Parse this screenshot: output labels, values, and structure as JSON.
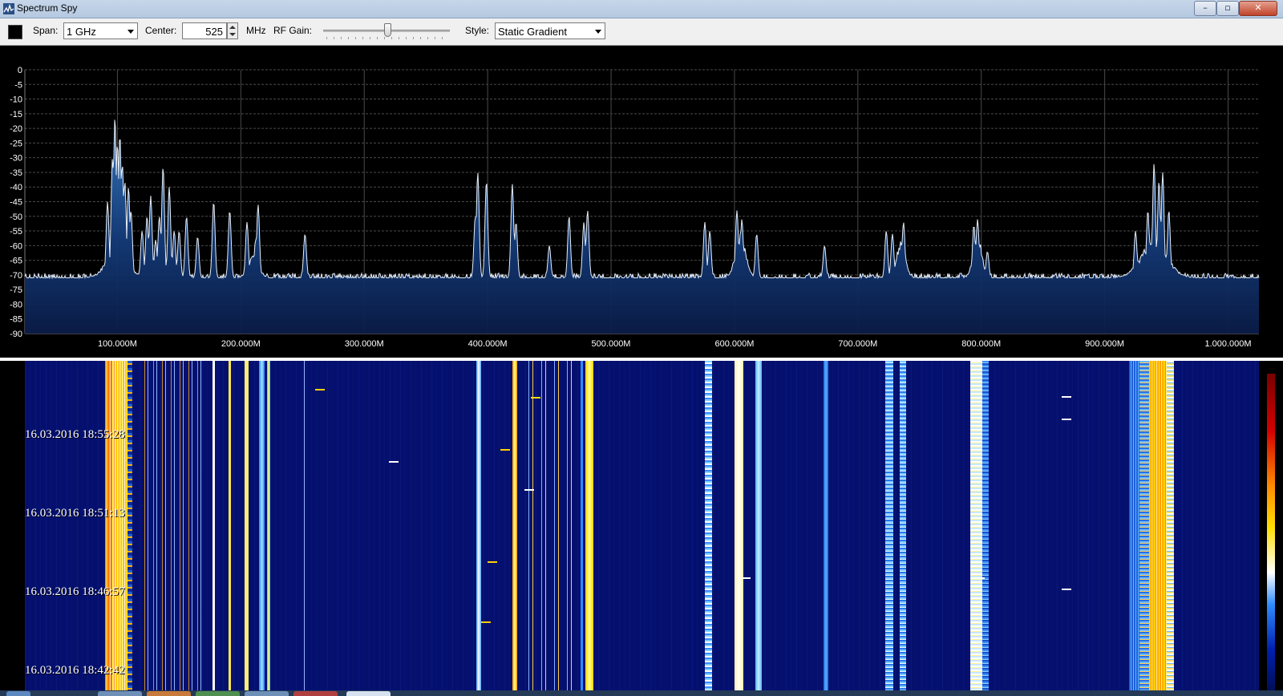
{
  "window": {
    "title": "Spectrum Spy"
  },
  "titlebar_buttons": {
    "minimize": "–",
    "maximize": "▫",
    "close": "✕"
  },
  "toolbar": {
    "span_label": "Span:",
    "span_value": "1 GHz",
    "center_label": "Center:",
    "center_value": "525",
    "center_unit": "MHz",
    "rf_gain_label": "RF Gain:",
    "rf_gain_level_percent": 52,
    "style_label": "Style:",
    "style_value": "Static Gradient"
  },
  "spectrum": {
    "y_ticks": [
      "0",
      "-5",
      "-10",
      "-15",
      "-20",
      "-25",
      "-30",
      "-35",
      "-40",
      "-45",
      "-50",
      "-55",
      "-60",
      "-65",
      "-70",
      "-75",
      "-80",
      "-85",
      "-90"
    ],
    "x_ticks": [
      "100.000M",
      "200.000M",
      "300.000M",
      "400.000M",
      "500.000M",
      "600.000M",
      "700.000M",
      "800.000M",
      "900.000M",
      "1.000.000M"
    ],
    "x_range_mhz": [
      25,
      1025
    ],
    "y_range_db": [
      0,
      -90
    ],
    "noise_floor_db": -71,
    "peaks": [
      {
        "mhz": 92,
        "db": -45
      },
      {
        "mhz": 96,
        "db": -30
      },
      {
        "mhz": 98,
        "db": -16
      },
      {
        "mhz": 100,
        "db": -25
      },
      {
        "mhz": 102,
        "db": -22
      },
      {
        "mhz": 104,
        "db": -32
      },
      {
        "mhz": 106,
        "db": -38
      },
      {
        "mhz": 109,
        "db": -40
      },
      {
        "mhz": 111,
        "db": -48
      },
      {
        "mhz": 120,
        "db": -55
      },
      {
        "mhz": 124,
        "db": -50
      },
      {
        "mhz": 127,
        "db": -43
      },
      {
        "mhz": 131,
        "db": -58
      },
      {
        "mhz": 134,
        "db": -50
      },
      {
        "mhz": 137,
        "db": -33
      },
      {
        "mhz": 142,
        "db": -40
      },
      {
        "mhz": 146,
        "db": -55
      },
      {
        "mhz": 150,
        "db": -55
      },
      {
        "mhz": 156,
        "db": -50
      },
      {
        "mhz": 165,
        "db": -57
      },
      {
        "mhz": 178,
        "db": -45
      },
      {
        "mhz": 191,
        "db": -48
      },
      {
        "mhz": 205,
        "db": -52
      },
      {
        "mhz": 212,
        "db": -58
      },
      {
        "mhz": 214,
        "db": -46
      },
      {
        "mhz": 252,
        "db": -56
      },
      {
        "mhz": 390,
        "db": -50
      },
      {
        "mhz": 392,
        "db": -35
      },
      {
        "mhz": 399,
        "db": -38
      },
      {
        "mhz": 420,
        "db": -39
      },
      {
        "mhz": 423,
        "db": -52
      },
      {
        "mhz": 450,
        "db": -60
      },
      {
        "mhz": 466,
        "db": -50
      },
      {
        "mhz": 478,
        "db": -52
      },
      {
        "mhz": 481,
        "db": -48
      },
      {
        "mhz": 576,
        "db": -52
      },
      {
        "mhz": 580,
        "db": -55
      },
      {
        "mhz": 602,
        "db": -48
      },
      {
        "mhz": 606,
        "db": -51
      },
      {
        "mhz": 618,
        "db": -56
      },
      {
        "mhz": 673,
        "db": -60
      },
      {
        "mhz": 723,
        "db": -55
      },
      {
        "mhz": 728,
        "db": -56
      },
      {
        "mhz": 737,
        "db": -52
      },
      {
        "mhz": 794,
        "db": -53
      },
      {
        "mhz": 797,
        "db": -51
      },
      {
        "mhz": 805,
        "db": -62
      },
      {
        "mhz": 925,
        "db": -55
      },
      {
        "mhz": 935,
        "db": -48
      },
      {
        "mhz": 940,
        "db": -32
      },
      {
        "mhz": 944,
        "db": -38
      },
      {
        "mhz": 947,
        "db": -35
      },
      {
        "mhz": 952,
        "db": -48
      }
    ]
  },
  "waterfall": {
    "timestamps": [
      "16.03.2016 18:55:28",
      "16.03.2016 18:51:13",
      "16.03.2016 18:46:57",
      "16.03.2016 18:42:42"
    ]
  },
  "colors": {
    "spectrum_bg": "#000000",
    "grid": "#4a4a4a",
    "trace": "#e6eef8",
    "fill_top": "#2a64a8",
    "waterfall_base": "#05106e",
    "toolbar_bg": "#f0f0f0"
  },
  "icons": {
    "app": "spectrum-app-icon",
    "minimize": "minimize-icon",
    "maximize": "maximize-icon",
    "close": "close-icon"
  }
}
